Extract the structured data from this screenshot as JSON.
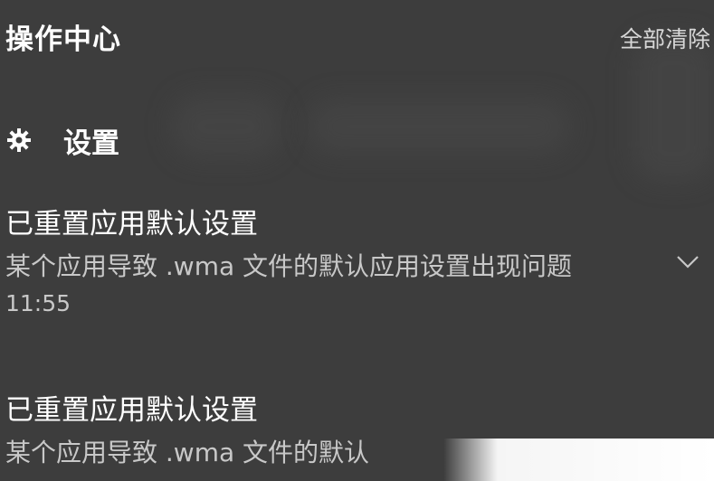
{
  "header": {
    "title": "操作中心",
    "clear_all": "全部清除"
  },
  "group": {
    "icon": "gear-icon",
    "title": "设置"
  },
  "notifications": [
    {
      "title": "已重置应用默认设置",
      "body": "某个应用导致 .wma 文件的默认应用设置出现问题",
      "time": "11:55"
    },
    {
      "title": "已重置应用默认设置",
      "body": "某个应用导致 .wma 文件的默认"
    }
  ],
  "colors": {
    "background": "#3d3d3d",
    "text_primary": "#ffffff",
    "text_secondary": "#c8c8c8"
  }
}
